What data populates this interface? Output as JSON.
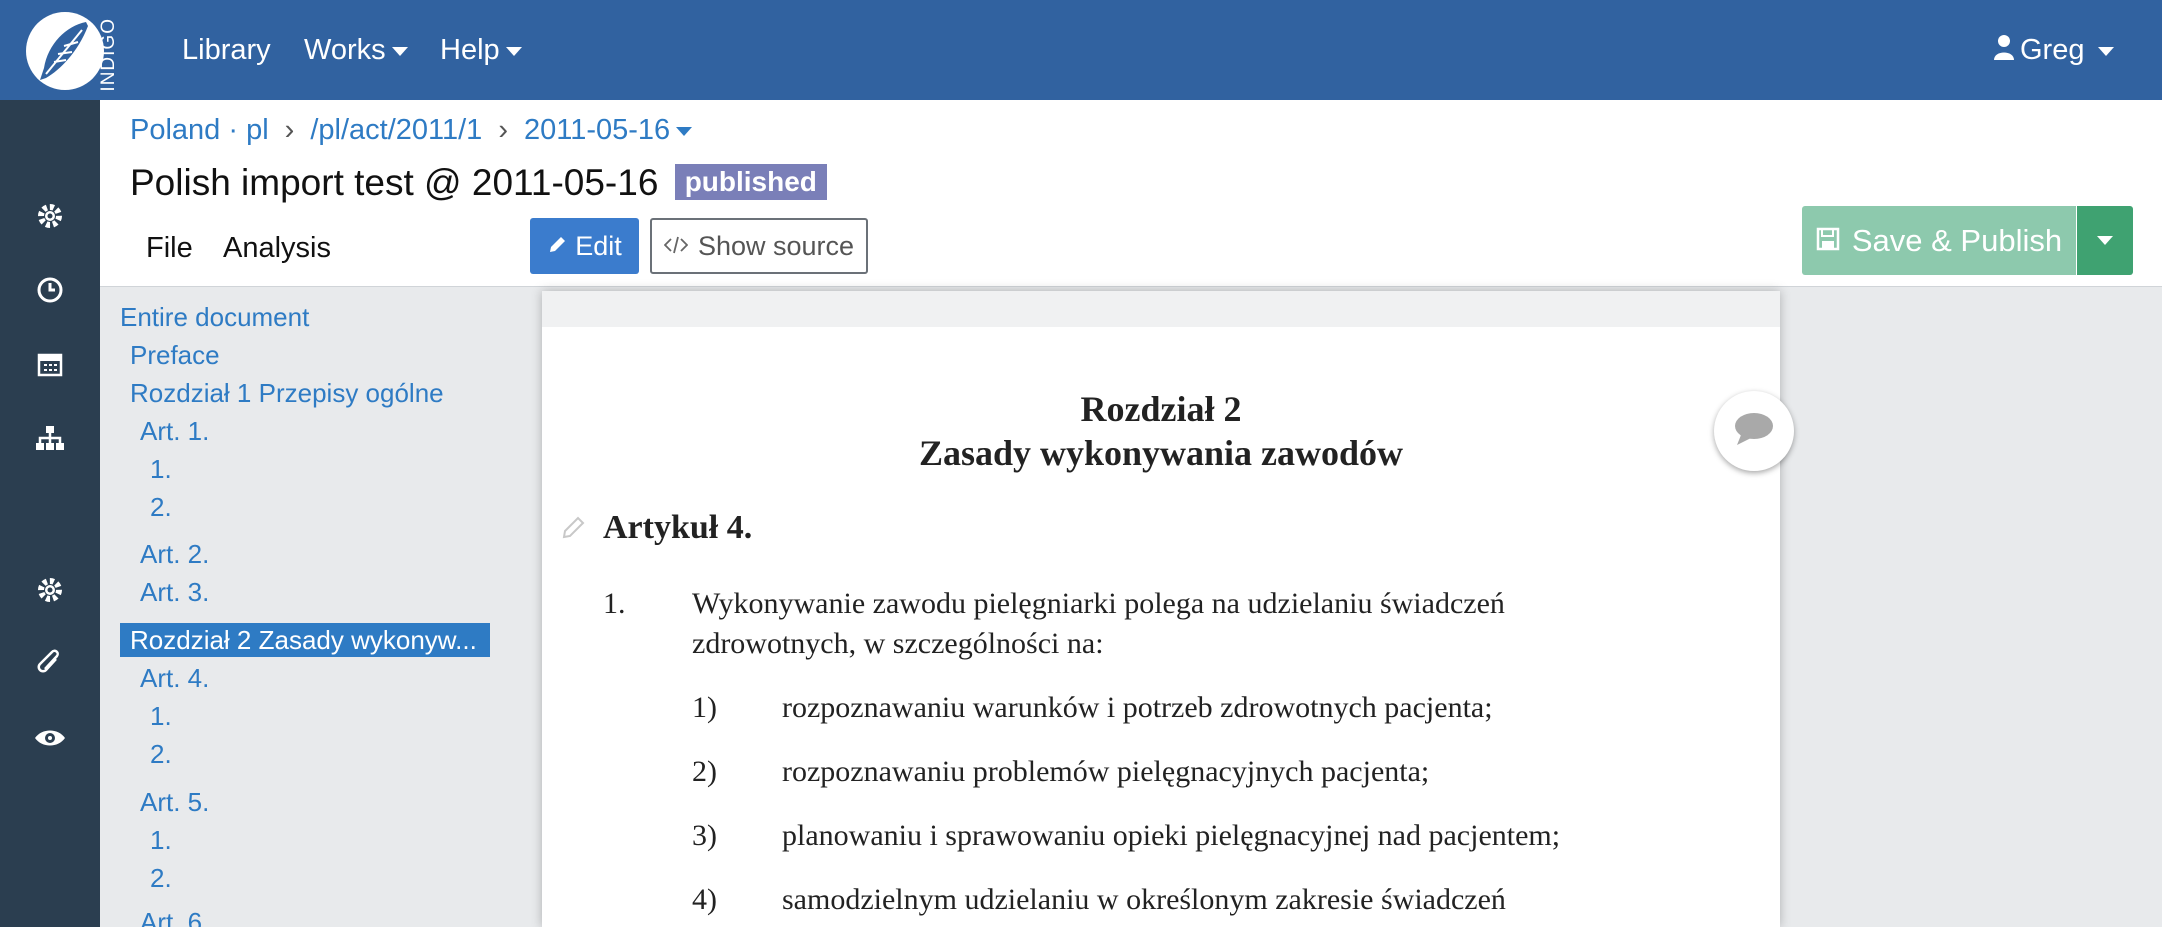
{
  "navbar": {
    "logo_text": "INDIGO",
    "items": [
      "Library",
      "Works",
      "Help"
    ],
    "user": "Greg"
  },
  "breadcrumb": {
    "place": "Poland · pl",
    "frbr": "/pl/act/2011/1",
    "date": "2011-05-16"
  },
  "title": "Polish import test @ 2011-05-16",
  "status_badge": "published",
  "tabs": [
    "File",
    "Analysis"
  ],
  "buttons": {
    "edit": "Edit",
    "show_source": "Show source",
    "save_publish": "Save & Publish"
  },
  "toc": [
    "Entire document",
    "Preface",
    "Rozdział 1 Przepisy ogólne",
    "Art. 1.",
    "1.",
    "2.",
    "Art. 2.",
    "Art. 3.",
    "Rozdział 2 Zasady wykonyw...",
    "Art. 4.",
    "1.",
    "2.",
    "Art. 5.",
    "1.",
    "2.",
    "Art. 6."
  ],
  "document": {
    "chapter_line1": "Rozdział 2",
    "chapter_line2": "Zasady wykonywania zawodów",
    "article": "Artykuł 4.",
    "section_num": "1.",
    "section_line1": "Wykonywanie zawodu pielęgniarki polega na udzielaniu świadczeń",
    "section_line2": "zdrowotnych, w szczególności na:",
    "points": [
      {
        "num": "1)",
        "text": "rozpoznawaniu warunków i potrzeb zdrowotnych pacjenta;"
      },
      {
        "num": "2)",
        "text": "rozpoznawaniu problemów pielęgnacyjnych pacjenta;"
      },
      {
        "num": "3)",
        "text": "planowaniu i sprawowaniu opieki pielęgnacyjnej nad pacjentem;"
      },
      {
        "num": "4)",
        "text": "samodzielnym udzielaniu w określonym zakresie świadczeń"
      }
    ]
  },
  "colors": {
    "navbar": "#3162a0",
    "sidebar": "#2b3e50",
    "link": "#2e7bc4",
    "badge": "#7a7fb8",
    "save": "#8dc9ad"
  },
  "icons": [
    "gear-icon",
    "clock-icon",
    "calendar-icon",
    "sitemap-icon",
    "gear-icon",
    "paperclip-icon",
    "eye-icon",
    "user-icon",
    "save-icon",
    "pencil-icon",
    "code-icon",
    "comment-icon"
  ]
}
